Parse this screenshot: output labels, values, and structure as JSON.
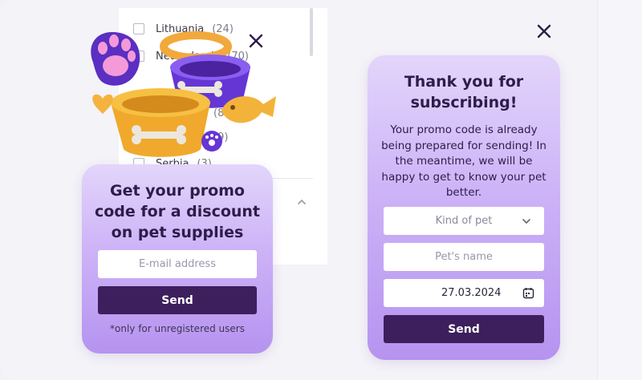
{
  "background_filter": {
    "rows": [
      {
        "label": "Lithuania",
        "count": "(24)"
      },
      {
        "label": "Netherlands",
        "count": "(70)"
      },
      {
        "label": "",
        "count": ""
      },
      {
        "label": "",
        "count": "(81)"
      },
      {
        "label": "",
        "count": "(9)"
      },
      {
        "label": "Serbia",
        "count": "(3)"
      }
    ]
  },
  "left_popup": {
    "title": "Get your promo code for a discount on pet supplies",
    "email_placeholder": "E-mail address",
    "send_label": "Send",
    "note": "*only for unregistered users"
  },
  "right_popup": {
    "title": "Thank you for subscribing!",
    "description": "Your promo code is already being prepared for sending! In the meantime, we will be happy to get to know your pet better.",
    "kind_of_pet_label": "Kind of pet",
    "pet_name_placeholder": "Pet's name",
    "date_value": "27.03.2024",
    "send_label": "Send"
  },
  "icons": {
    "close": "close-icon",
    "select": "chevron-down-icon",
    "calendar": "calendar-icon",
    "collapse": "chevron-up-icon"
  },
  "colors": {
    "button": "#3c1f5c",
    "card_top": "#e3d5fb",
    "card_bottom": "#b593f0",
    "title_text": "#2e1c4a"
  }
}
